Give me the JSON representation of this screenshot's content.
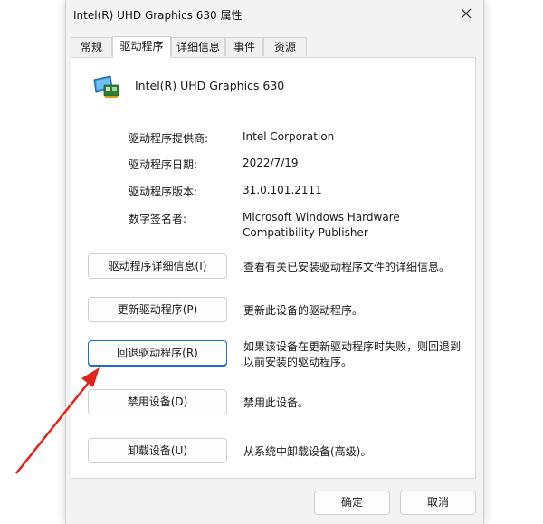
{
  "window": {
    "title": "Intel(R) UHD Graphics 630 属性"
  },
  "tabs": [
    {
      "label": "常规"
    },
    {
      "label": "驱动程序"
    },
    {
      "label": "详细信息"
    },
    {
      "label": "事件"
    },
    {
      "label": "资源"
    }
  ],
  "active_tab": "驱动程序",
  "device": {
    "name": "Intel(R) UHD Graphics 630",
    "icon": "display-adapter-icon"
  },
  "properties": [
    {
      "label": "驱动程序提供商:",
      "value": "Intel Corporation"
    },
    {
      "label": "驱动程序日期:",
      "value": "2022/7/19"
    },
    {
      "label": "驱动程序版本:",
      "value": "31.0.101.2111"
    },
    {
      "label": "数字签名者:",
      "value_line1": "Microsoft Windows Hardware",
      "value_line2": "Compatibility Publisher"
    }
  ],
  "actions": [
    {
      "button": "驱动程序详细信息(I)",
      "desc1": "查看有关已安装驱动程序文件的详细信息。",
      "desc2": ""
    },
    {
      "button": "更新驱动程序(P)",
      "desc1": "更新此设备的驱动程序。",
      "desc2": ""
    },
    {
      "button": "回退驱动程序(R)",
      "desc1": "如果该设备在更新驱动程序时失败，则回退到",
      "desc2": "以前安装的驱动程序。"
    },
    {
      "button": "禁用设备(D)",
      "desc1": "禁用此设备。",
      "desc2": ""
    },
    {
      "button": "卸载设备(U)",
      "desc1": "从系统中卸载设备(高级)。",
      "desc2": ""
    }
  ],
  "footer": {
    "ok": "确定",
    "cancel": "取消"
  },
  "colors": {
    "annotation_arrow": "#e0241b",
    "focus_border": "#1a6ec9",
    "dialog_bg": "#f3f3f3"
  }
}
